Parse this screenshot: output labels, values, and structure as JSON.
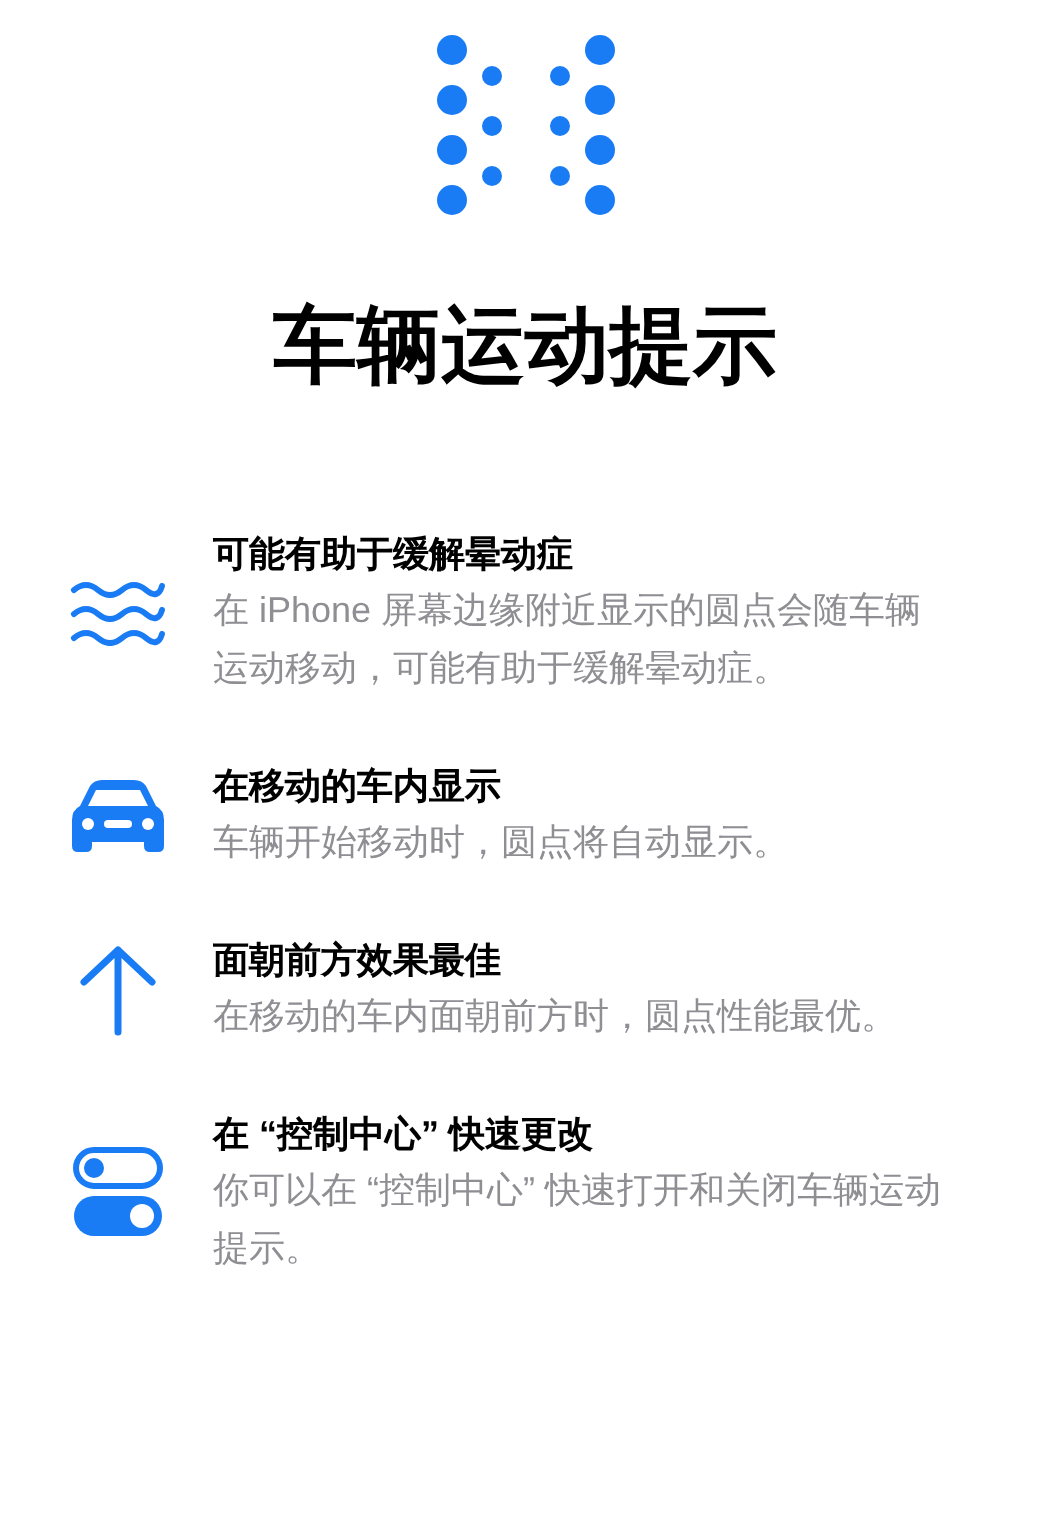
{
  "title": "车辆运动提示",
  "features": [
    {
      "kind": "waves",
      "heading": "可能有助于缓解晕动症",
      "description": "在 iPhone 屏幕边缘附近显示的圆点会随车辆运动移动，可能有助于缓解晕动症。"
    },
    {
      "kind": "car",
      "heading": "在移动的车内显示",
      "description": "车辆开始移动时，圆点将自动显示。"
    },
    {
      "kind": "arrow",
      "heading": "面朝前方效果最佳",
      "description": "在移动的车内面朝前方时，圆点性能最优。"
    },
    {
      "kind": "toggles",
      "heading": "在 “控制中心” 快速更改",
      "description": "你可以在 “控制中心” 快速打开和关闭车辆运动提示。"
    }
  ]
}
